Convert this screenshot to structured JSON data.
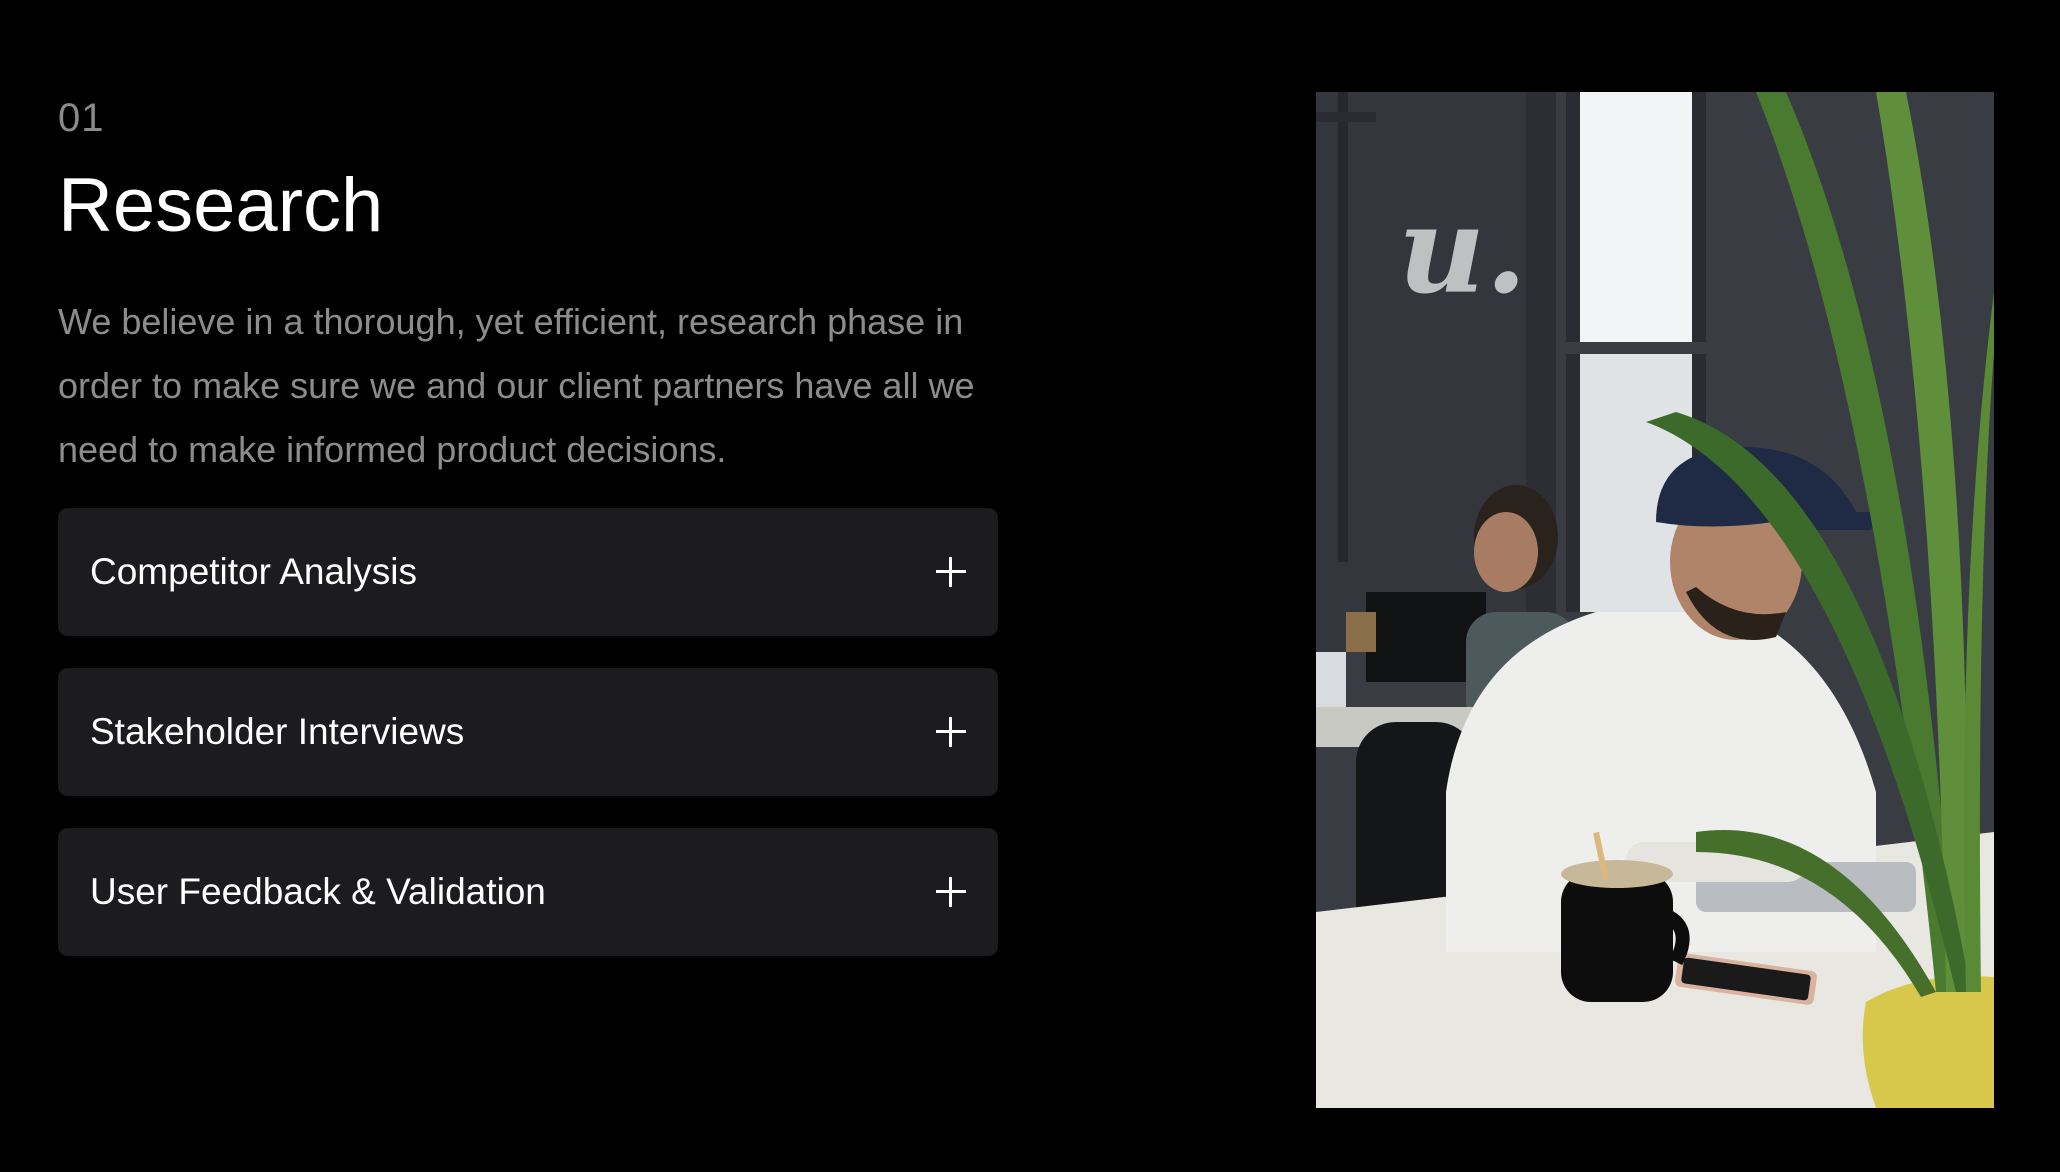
{
  "section": {
    "number": "01",
    "title": "Research",
    "description": "We believe in a thorough, yet efficient, research phase in order to make sure we and our client partners have all we need to make informed product decisions."
  },
  "accordions": [
    {
      "label": "Competitor Analysis",
      "icon": "plus-icon"
    },
    {
      "label": "Stakeholder Interviews",
      "icon": "plus-icon"
    },
    {
      "label": "User Feedback & Validation",
      "icon": "plus-icon"
    }
  ],
  "photo": {
    "wall_logo": "u."
  },
  "colors": {
    "background": "#000000",
    "panel": "#1c1c1e",
    "muted_text": "#8c8c8c",
    "text": "#ffffff"
  }
}
